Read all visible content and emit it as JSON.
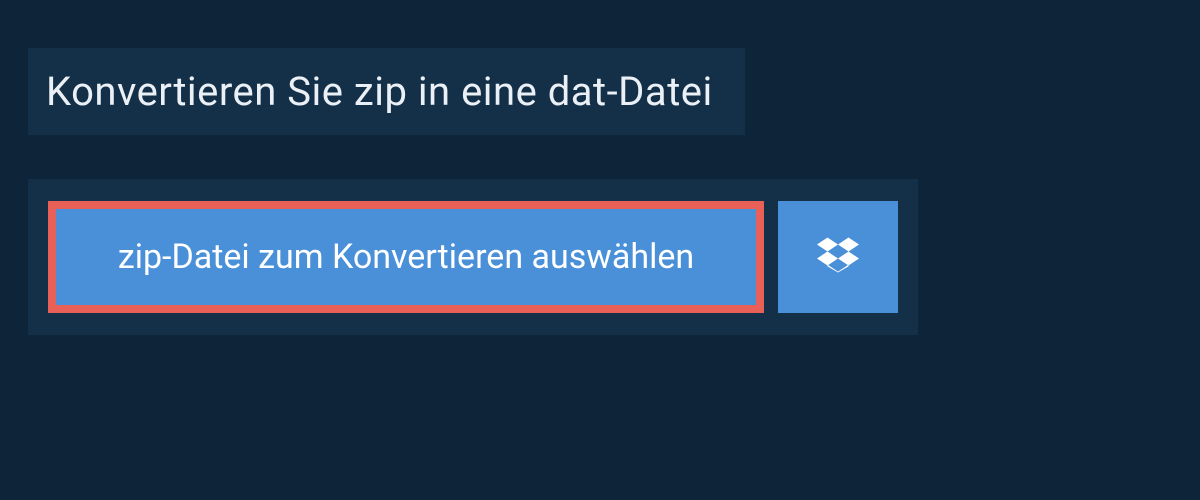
{
  "header": {
    "title": "Konvertieren Sie zip in eine dat-Datei"
  },
  "upload": {
    "select_label": "zip-Datei zum Konvertieren auswählen",
    "dropbox_icon": "dropbox"
  },
  "colors": {
    "page_bg": "#0e2438",
    "panel_bg": "#143049",
    "button_bg": "#4a90d9",
    "highlight_border": "#e86058",
    "text": "#ffffff"
  }
}
